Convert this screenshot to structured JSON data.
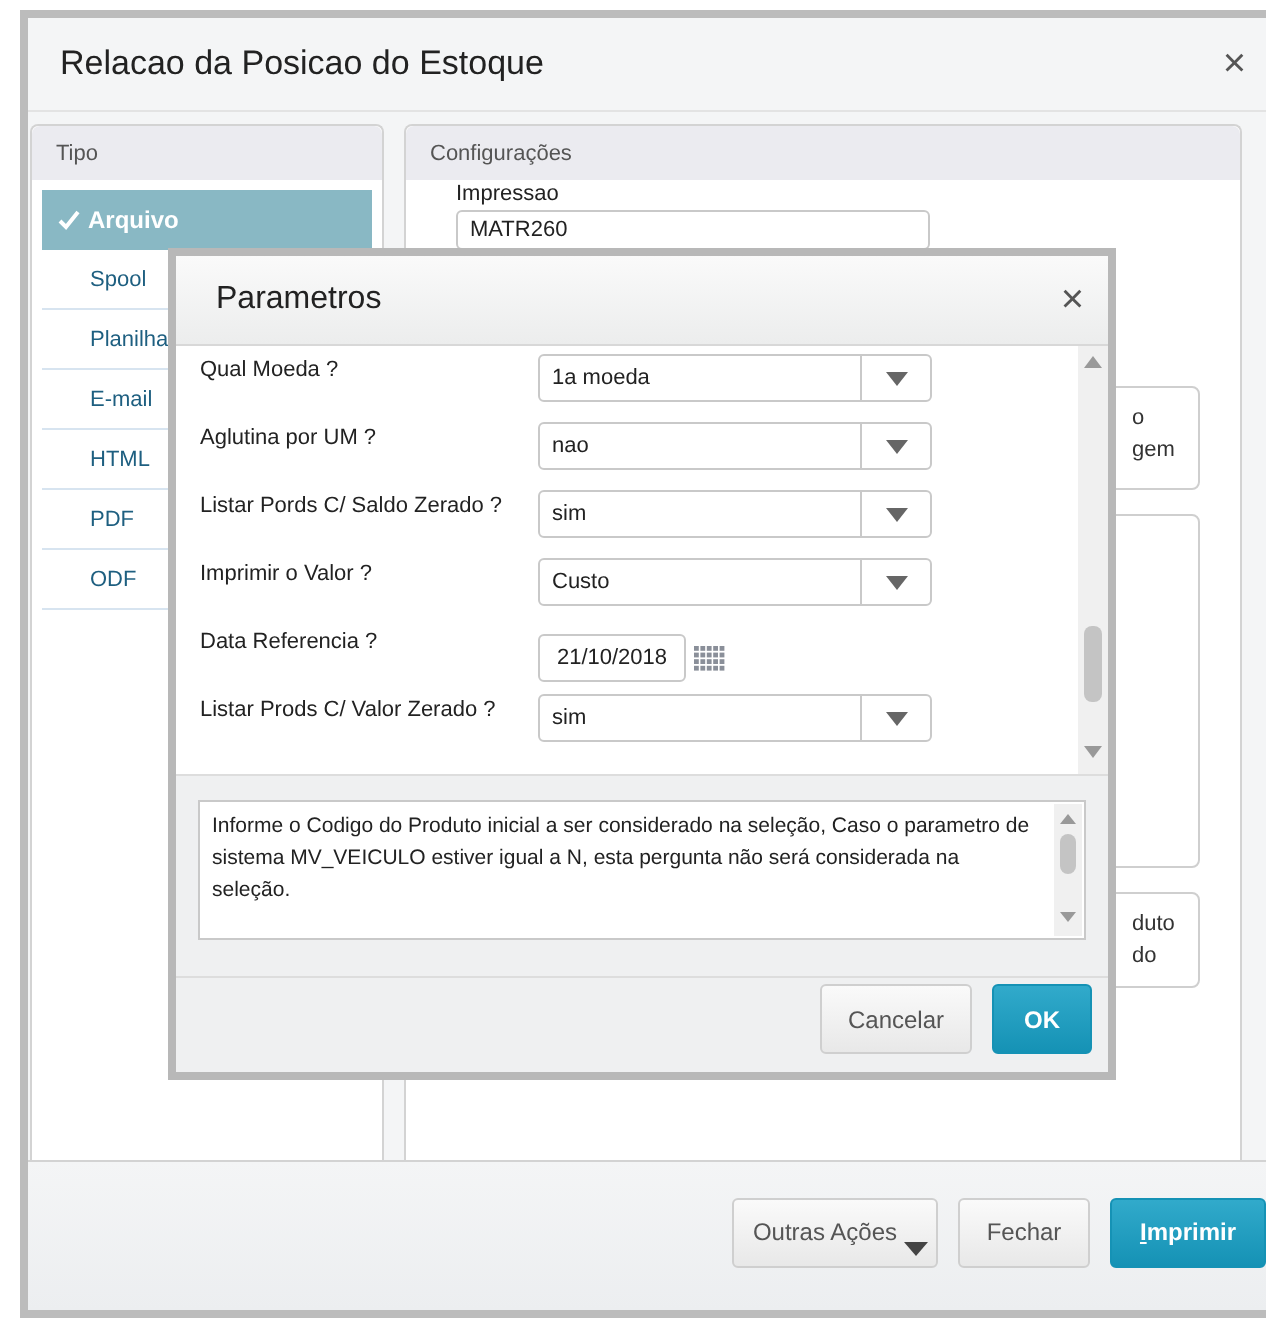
{
  "window": {
    "title": "Relacao da Posicao do Estoque",
    "close": "×"
  },
  "tipo": {
    "header": "Tipo",
    "items": [
      {
        "label": "Arquivo",
        "selected": true
      },
      {
        "label": "Spool",
        "selected": false
      },
      {
        "label": "Planilha",
        "selected": false
      },
      {
        "label": "E-mail",
        "selected": false
      },
      {
        "label": "HTML",
        "selected": false
      },
      {
        "label": "PDF",
        "selected": false
      },
      {
        "label": "ODF",
        "selected": false
      }
    ]
  },
  "configuracoes": {
    "header": "Configurações",
    "impressao_label": "Impressao",
    "impressao_value": "MATR260",
    "cards": [
      {
        "lines": [
          "o",
          "gem"
        ]
      },
      {
        "lines": [
          "duto",
          "do"
        ]
      }
    ]
  },
  "footer_buttons": [
    {
      "label": "Outras Ações",
      "kind": "menu"
    },
    {
      "label": "Fechar",
      "kind": "default"
    },
    {
      "label": "Imprimir",
      "kind": "primary"
    }
  ],
  "dialog": {
    "title": "Parametros",
    "close": "×",
    "rows": [
      {
        "label": "Qual Moeda ?",
        "kind": "select",
        "value": "1a moeda"
      },
      {
        "label": "Aglutina por UM ?",
        "kind": "select",
        "value": "nao"
      },
      {
        "label": "Listar Pords C/ Saldo Zerado ?",
        "kind": "select",
        "value": "sim"
      },
      {
        "label": "Imprimir o Valor ?",
        "kind": "select",
        "value": "Custo"
      },
      {
        "label": "Data Referencia ?",
        "kind": "date",
        "value": "21/10/2018"
      },
      {
        "label": "Listar Prods C/ Valor Zerado ?",
        "kind": "select",
        "value": "sim"
      }
    ],
    "help": "Informe o Codigo do Produto inicial a ser considerado na seleção, Caso o parametro de sistema MV_VEICULO estiver igual a N, esta pergunta não será considerada na seleção.",
    "buttons": [
      {
        "label": "Cancelar",
        "kind": "default"
      },
      {
        "label": "OK",
        "kind": "primary"
      }
    ]
  }
}
